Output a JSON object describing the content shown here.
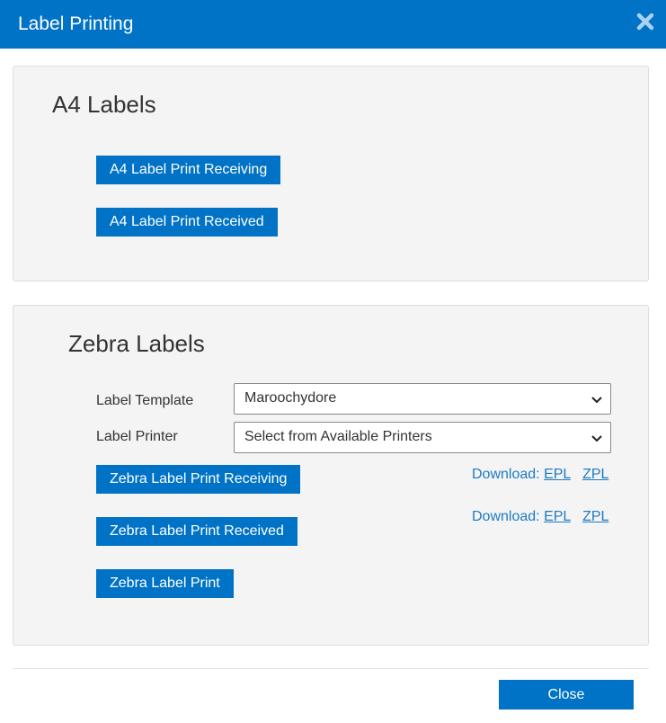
{
  "dialog": {
    "title": "Label Printing",
    "close_icon": "close-x-icon"
  },
  "a4": {
    "heading": "A4 Labels",
    "btn_receiving": "A4 Label Print Receiving",
    "btn_received": "A4 Label Print Received"
  },
  "zebra": {
    "heading": "Zebra Labels",
    "template_label": "Label Template",
    "template_value": "Maroochydore",
    "printer_label": "Label Printer",
    "printer_value": "Select from Available Printers",
    "btn_receiving": "Zebra Label Print Receiving",
    "btn_received": "Zebra Label Print Received",
    "btn_print": "Zebra Label Print",
    "download_rows": [
      {
        "prefix": "Download:",
        "epl": "EPL",
        "zpl": "ZPL"
      },
      {
        "prefix": "Download:",
        "epl": "EPL",
        "zpl": "ZPL"
      }
    ]
  },
  "footer": {
    "close_label": "Close"
  },
  "colors": {
    "accent": "#0073c6",
    "link": "#1b7bc4",
    "panel_bg": "#f4f4f4"
  }
}
